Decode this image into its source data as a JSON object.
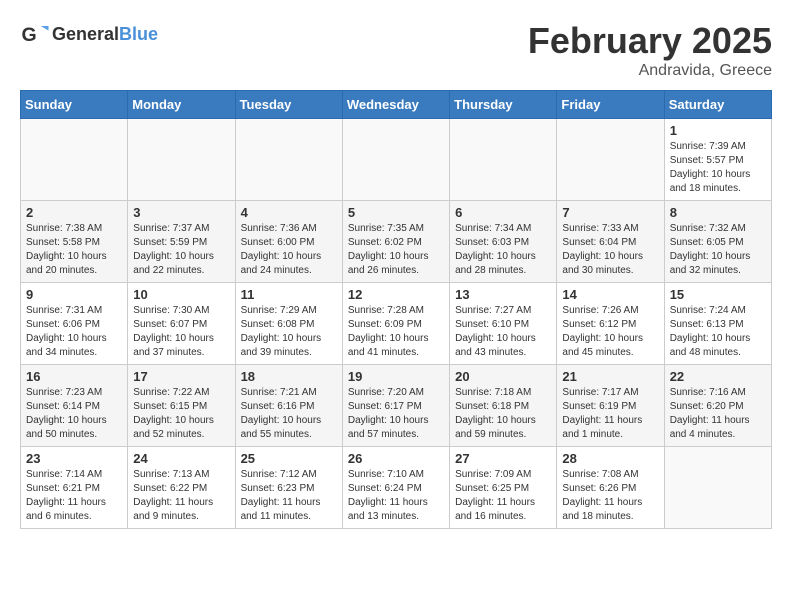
{
  "header": {
    "logo_general": "General",
    "logo_blue": "Blue",
    "month": "February 2025",
    "location": "Andravida, Greece"
  },
  "weekdays": [
    "Sunday",
    "Monday",
    "Tuesday",
    "Wednesday",
    "Thursday",
    "Friday",
    "Saturday"
  ],
  "weeks": [
    [
      {
        "day": "",
        "info": ""
      },
      {
        "day": "",
        "info": ""
      },
      {
        "day": "",
        "info": ""
      },
      {
        "day": "",
        "info": ""
      },
      {
        "day": "",
        "info": ""
      },
      {
        "day": "",
        "info": ""
      },
      {
        "day": "1",
        "info": "Sunrise: 7:39 AM\nSunset: 5:57 PM\nDaylight: 10 hours and 18 minutes."
      }
    ],
    [
      {
        "day": "2",
        "info": "Sunrise: 7:38 AM\nSunset: 5:58 PM\nDaylight: 10 hours and 20 minutes."
      },
      {
        "day": "3",
        "info": "Sunrise: 7:37 AM\nSunset: 5:59 PM\nDaylight: 10 hours and 22 minutes."
      },
      {
        "day": "4",
        "info": "Sunrise: 7:36 AM\nSunset: 6:00 PM\nDaylight: 10 hours and 24 minutes."
      },
      {
        "day": "5",
        "info": "Sunrise: 7:35 AM\nSunset: 6:02 PM\nDaylight: 10 hours and 26 minutes."
      },
      {
        "day": "6",
        "info": "Sunrise: 7:34 AM\nSunset: 6:03 PM\nDaylight: 10 hours and 28 minutes."
      },
      {
        "day": "7",
        "info": "Sunrise: 7:33 AM\nSunset: 6:04 PM\nDaylight: 10 hours and 30 minutes."
      },
      {
        "day": "8",
        "info": "Sunrise: 7:32 AM\nSunset: 6:05 PM\nDaylight: 10 hours and 32 minutes."
      }
    ],
    [
      {
        "day": "9",
        "info": "Sunrise: 7:31 AM\nSunset: 6:06 PM\nDaylight: 10 hours and 34 minutes."
      },
      {
        "day": "10",
        "info": "Sunrise: 7:30 AM\nSunset: 6:07 PM\nDaylight: 10 hours and 37 minutes."
      },
      {
        "day": "11",
        "info": "Sunrise: 7:29 AM\nSunset: 6:08 PM\nDaylight: 10 hours and 39 minutes."
      },
      {
        "day": "12",
        "info": "Sunrise: 7:28 AM\nSunset: 6:09 PM\nDaylight: 10 hours and 41 minutes."
      },
      {
        "day": "13",
        "info": "Sunrise: 7:27 AM\nSunset: 6:10 PM\nDaylight: 10 hours and 43 minutes."
      },
      {
        "day": "14",
        "info": "Sunrise: 7:26 AM\nSunset: 6:12 PM\nDaylight: 10 hours and 45 minutes."
      },
      {
        "day": "15",
        "info": "Sunrise: 7:24 AM\nSunset: 6:13 PM\nDaylight: 10 hours and 48 minutes."
      }
    ],
    [
      {
        "day": "16",
        "info": "Sunrise: 7:23 AM\nSunset: 6:14 PM\nDaylight: 10 hours and 50 minutes."
      },
      {
        "day": "17",
        "info": "Sunrise: 7:22 AM\nSunset: 6:15 PM\nDaylight: 10 hours and 52 minutes."
      },
      {
        "day": "18",
        "info": "Sunrise: 7:21 AM\nSunset: 6:16 PM\nDaylight: 10 hours and 55 minutes."
      },
      {
        "day": "19",
        "info": "Sunrise: 7:20 AM\nSunset: 6:17 PM\nDaylight: 10 hours and 57 minutes."
      },
      {
        "day": "20",
        "info": "Sunrise: 7:18 AM\nSunset: 6:18 PM\nDaylight: 10 hours and 59 minutes."
      },
      {
        "day": "21",
        "info": "Sunrise: 7:17 AM\nSunset: 6:19 PM\nDaylight: 11 hours and 1 minute."
      },
      {
        "day": "22",
        "info": "Sunrise: 7:16 AM\nSunset: 6:20 PM\nDaylight: 11 hours and 4 minutes."
      }
    ],
    [
      {
        "day": "23",
        "info": "Sunrise: 7:14 AM\nSunset: 6:21 PM\nDaylight: 11 hours and 6 minutes."
      },
      {
        "day": "24",
        "info": "Sunrise: 7:13 AM\nSunset: 6:22 PM\nDaylight: 11 hours and 9 minutes."
      },
      {
        "day": "25",
        "info": "Sunrise: 7:12 AM\nSunset: 6:23 PM\nDaylight: 11 hours and 11 minutes."
      },
      {
        "day": "26",
        "info": "Sunrise: 7:10 AM\nSunset: 6:24 PM\nDaylight: 11 hours and 13 minutes."
      },
      {
        "day": "27",
        "info": "Sunrise: 7:09 AM\nSunset: 6:25 PM\nDaylight: 11 hours and 16 minutes."
      },
      {
        "day": "28",
        "info": "Sunrise: 7:08 AM\nSunset: 6:26 PM\nDaylight: 11 hours and 18 minutes."
      },
      {
        "day": "",
        "info": ""
      }
    ]
  ]
}
